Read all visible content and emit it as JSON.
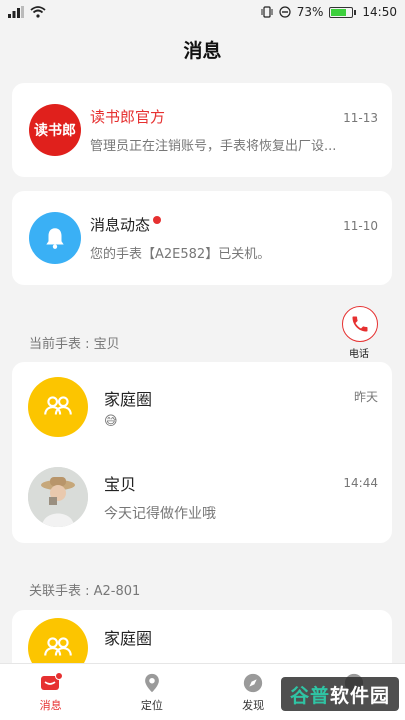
{
  "status_bar": {
    "battery": "73%",
    "time": "14:50"
  },
  "page_title": "消息",
  "messages": [
    {
      "title": "读书郎官方",
      "subtitle": "管理员正在注销账号，手表将恢复出厂设...",
      "time": "11-13",
      "avatar_text": "读书郎",
      "unread": false
    },
    {
      "title": "消息动态",
      "subtitle": "您的手表【A2E582】已关机。",
      "time": "11-10",
      "unread": true
    }
  ],
  "call_label": "电话",
  "current_watch": {
    "label": "当前手表 : 宝贝",
    "items": [
      {
        "title": "家庭圈",
        "subtitle": "😅",
        "time": "昨天"
      },
      {
        "title": "宝贝",
        "subtitle": "今天记得做作业哦",
        "time": "14:44"
      }
    ]
  },
  "linked_watch": {
    "label": "关联手表 : A2-801",
    "items": [
      {
        "title": "家庭圈"
      }
    ]
  },
  "tabs": [
    {
      "label": "消息",
      "icon": "message-icon",
      "active": true
    },
    {
      "label": "定位",
      "icon": "location-icon",
      "active": false
    },
    {
      "label": "发现",
      "icon": "compass-icon",
      "active": false
    },
    {
      "label": "",
      "icon": "profile-icon",
      "active": false
    }
  ],
  "watermark": {
    "part1": "谷普",
    "part2": "软件园"
  },
  "colors": {
    "accent": "#e63030",
    "yellow": "#fcc500",
    "blue": "#3ab0f5"
  }
}
